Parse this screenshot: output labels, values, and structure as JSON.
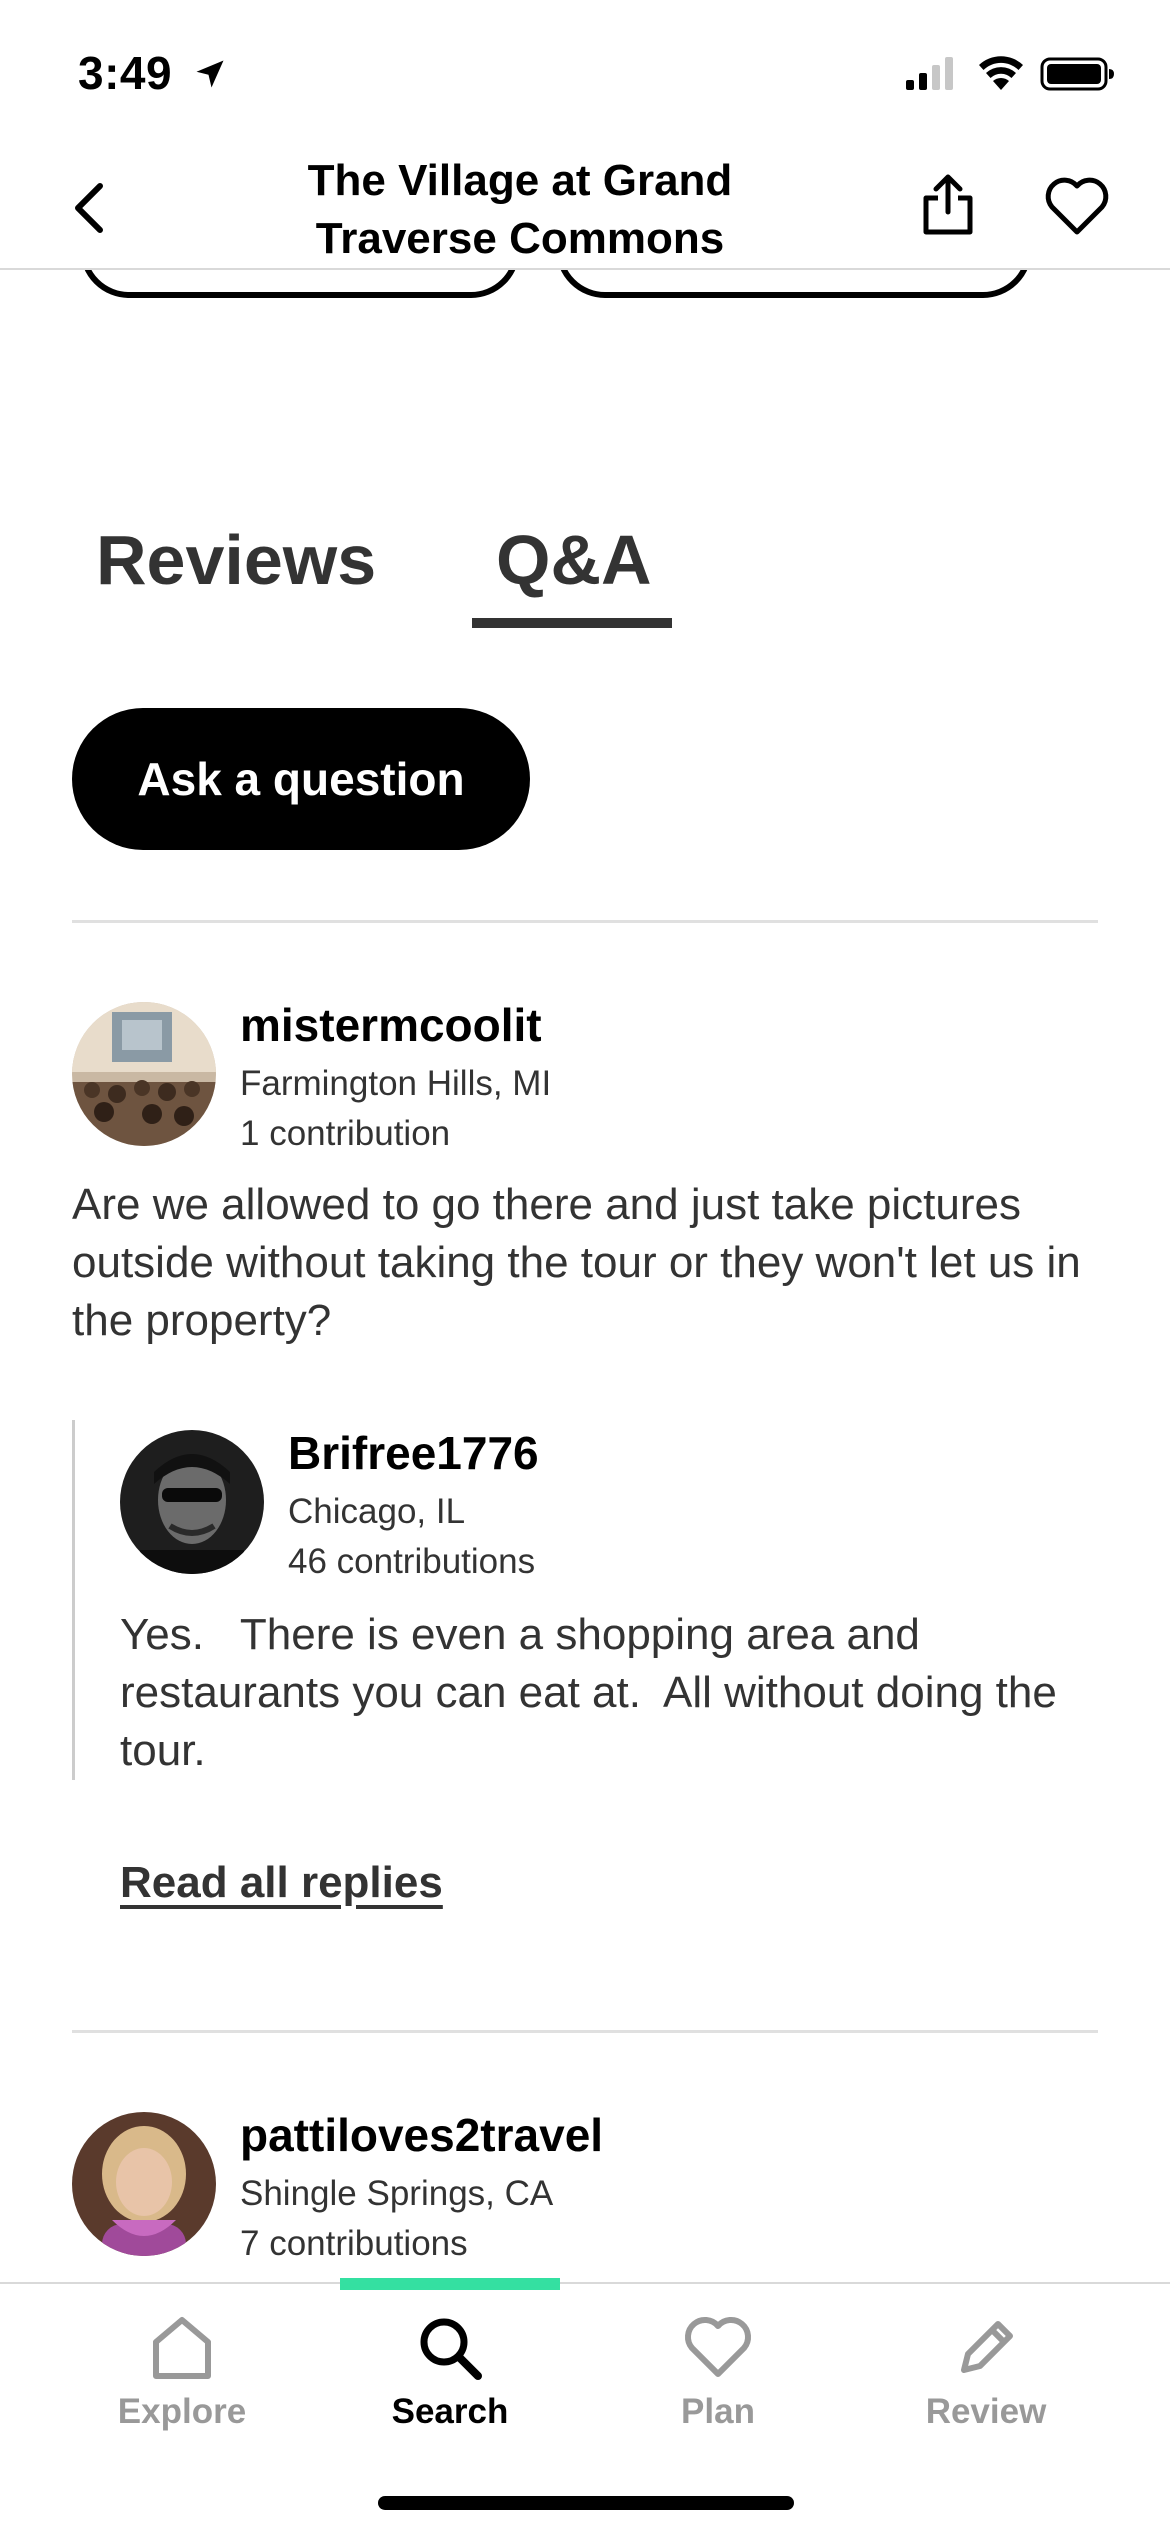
{
  "status_bar": {
    "time": "3:49"
  },
  "header": {
    "title_line1": "The Village at Grand",
    "title_line2": "Traverse Commons"
  },
  "tabs": [
    {
      "label": "Reviews",
      "active": false
    },
    {
      "label": "Q&A",
      "active": true
    }
  ],
  "ask_button": {
    "label": "Ask a question"
  },
  "questions": [
    {
      "user": "mistermcoolit",
      "location": "Farmington Hills, MI",
      "contributions": "1 contribution",
      "text": "Are we allowed to go there and just take pictures outside without taking the tour or they won't let us in the property?",
      "reply": {
        "user": "Brifree1776",
        "location": "Chicago, IL",
        "contributions": "46 contributions",
        "text": "Yes.   There is even a shopping area and restaurants you can eat at.  All without doing the tour."
      },
      "read_replies_label": "Read all replies"
    },
    {
      "user": "pattiloves2travel",
      "location": "Shingle Springs, CA",
      "contributions": "7 contributions"
    }
  ],
  "bottom_nav": {
    "items": [
      {
        "label": "Explore",
        "icon": "home-icon",
        "active": false
      },
      {
        "label": "Search",
        "icon": "search-icon",
        "active": true
      },
      {
        "label": "Plan",
        "icon": "heart-icon",
        "active": false
      },
      {
        "label": "Review",
        "icon": "pencil-icon",
        "active": false
      }
    ],
    "active_color": "#34e0a1"
  }
}
